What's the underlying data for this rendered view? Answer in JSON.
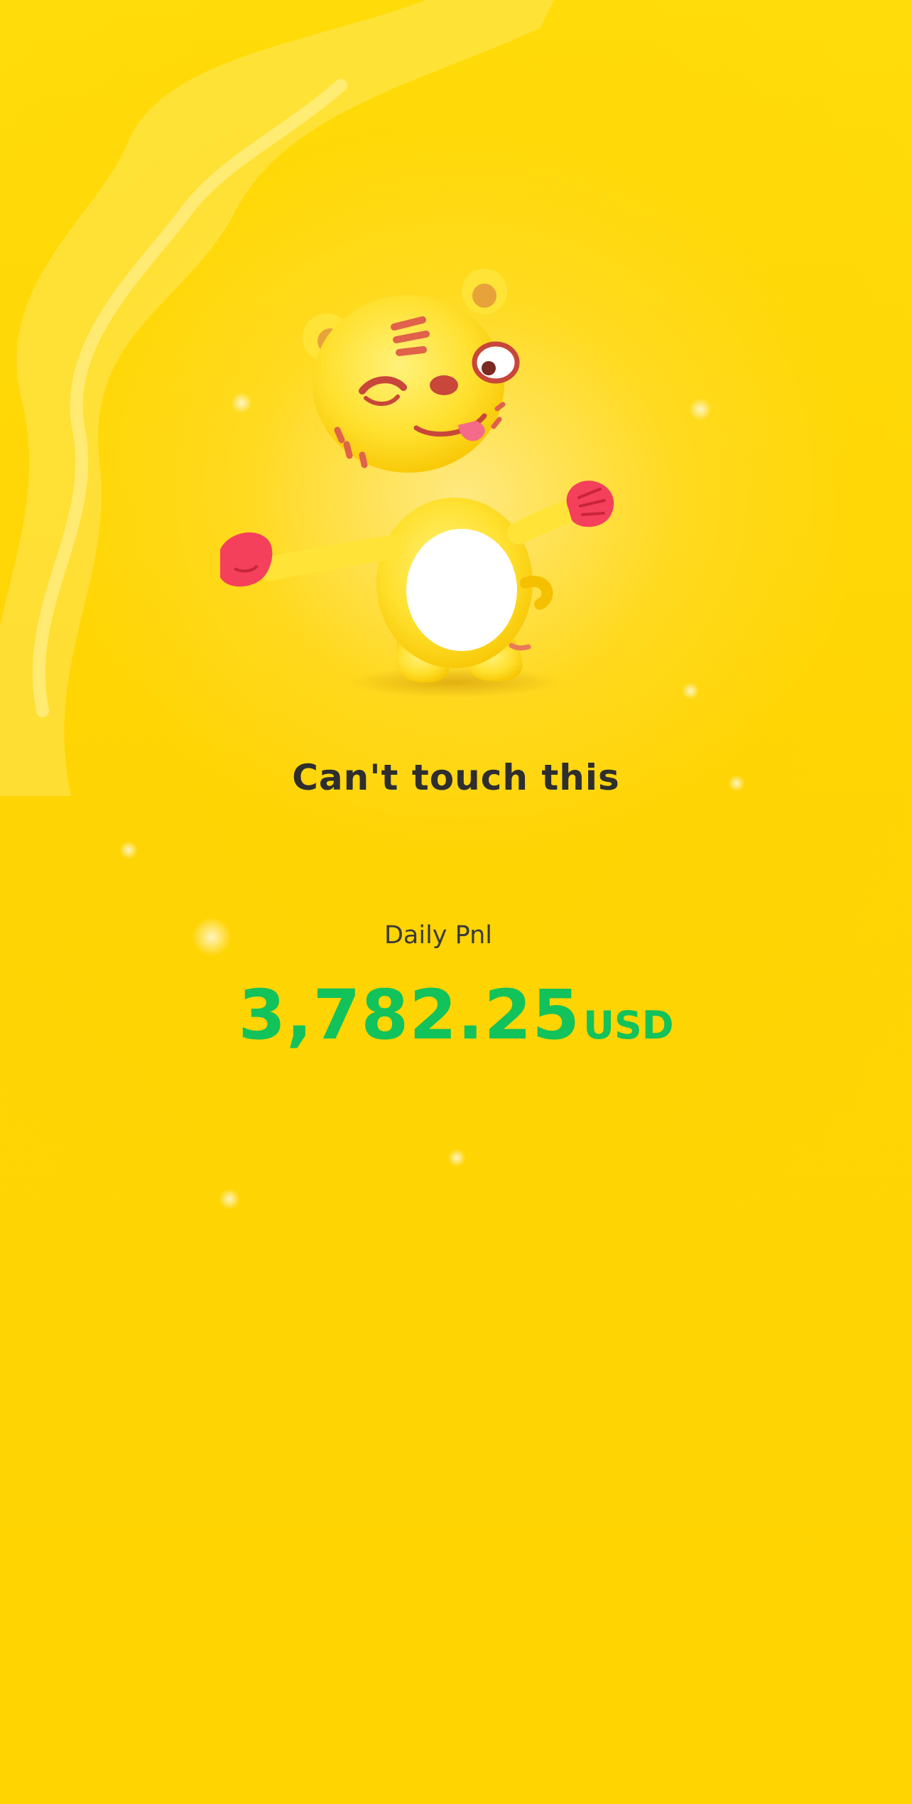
{
  "screen": {
    "title": "Can't touch this",
    "pnl_label": "Daily Pnl",
    "pnl_amount": "3,782.25",
    "pnl_currency": "USD"
  },
  "mascot": {
    "icon": "winking-tiger-mascot-icon"
  },
  "colors": {
    "background": "#FFD700",
    "title_text": "#2E2E2E",
    "label_text": "#3A3A3A",
    "positive_value": "#12C25A"
  }
}
